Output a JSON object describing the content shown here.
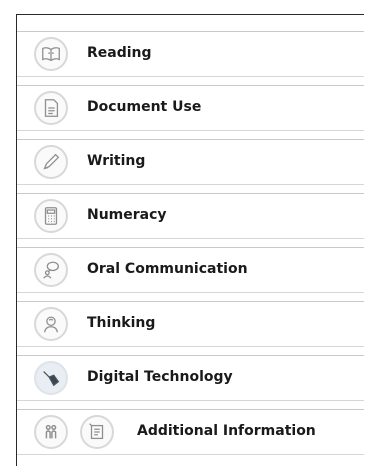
{
  "menu": {
    "items": [
      {
        "label": "Reading",
        "icon": "book-icon"
      },
      {
        "label": "Document Use",
        "icon": "document-icon"
      },
      {
        "label": "Writing",
        "icon": "pencil-icon"
      },
      {
        "label": "Numeracy",
        "icon": "calculator-icon"
      },
      {
        "label": "Oral Communication",
        "icon": "speech-person-icon"
      },
      {
        "label": "Thinking",
        "icon": "thinking-head-icon"
      },
      {
        "label": "Digital Technology",
        "icon": "mouse-icon"
      }
    ],
    "additional": {
      "label": "Additional Information",
      "icons": [
        "people-icon",
        "info-sheet-icon"
      ]
    }
  },
  "colors": {
    "border": "#c9c9c9",
    "icon_stroke": "#9a9a9a",
    "text": "#1a1a1a"
  }
}
